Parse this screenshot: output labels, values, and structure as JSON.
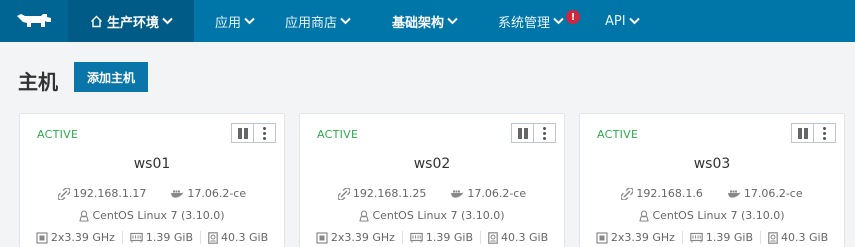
{
  "nav": {
    "environment": "生产环境",
    "items": [
      {
        "label": "应用"
      },
      {
        "label": "应用商店"
      },
      {
        "label": "基础架构"
      },
      {
        "label": "系统管理"
      },
      {
        "label": "API"
      }
    ],
    "alert_symbol": "!"
  },
  "page": {
    "title": "主机",
    "add_host_label": "添加主机"
  },
  "hosts": [
    {
      "state": "ACTIVE",
      "name": "ws01",
      "ip": "192.168.1.17",
      "docker": "17.06.2-ce",
      "os": "CentOS Linux 7 (3.10.0)",
      "cpu": "2x3.39 GHz",
      "memory": "1.39 GiB",
      "storage": "40.3 GiB"
    },
    {
      "state": "ACTIVE",
      "name": "ws02",
      "ip": "192.168.1.25",
      "docker": "17.06.2-ce",
      "os": "CentOS Linux 7 (3.10.0)",
      "cpu": "2x3.39 GHz",
      "memory": "1.39 GiB",
      "storage": "40.3 GiB"
    },
    {
      "state": "ACTIVE",
      "name": "ws03",
      "ip": "192.168.1.6",
      "docker": "17.06.2-ce",
      "os": "CentOS Linux 7 (3.10.0)",
      "cpu": "2x3.39 GHz",
      "memory": "1.39 GiB",
      "storage": "40.3 GiB"
    }
  ],
  "colors": {
    "nav_bg": "#0075a8",
    "env_bg": "#005b86",
    "active_state": "#2eaa4f",
    "alert": "#d0253a",
    "button_bg": "#0a75a8"
  }
}
